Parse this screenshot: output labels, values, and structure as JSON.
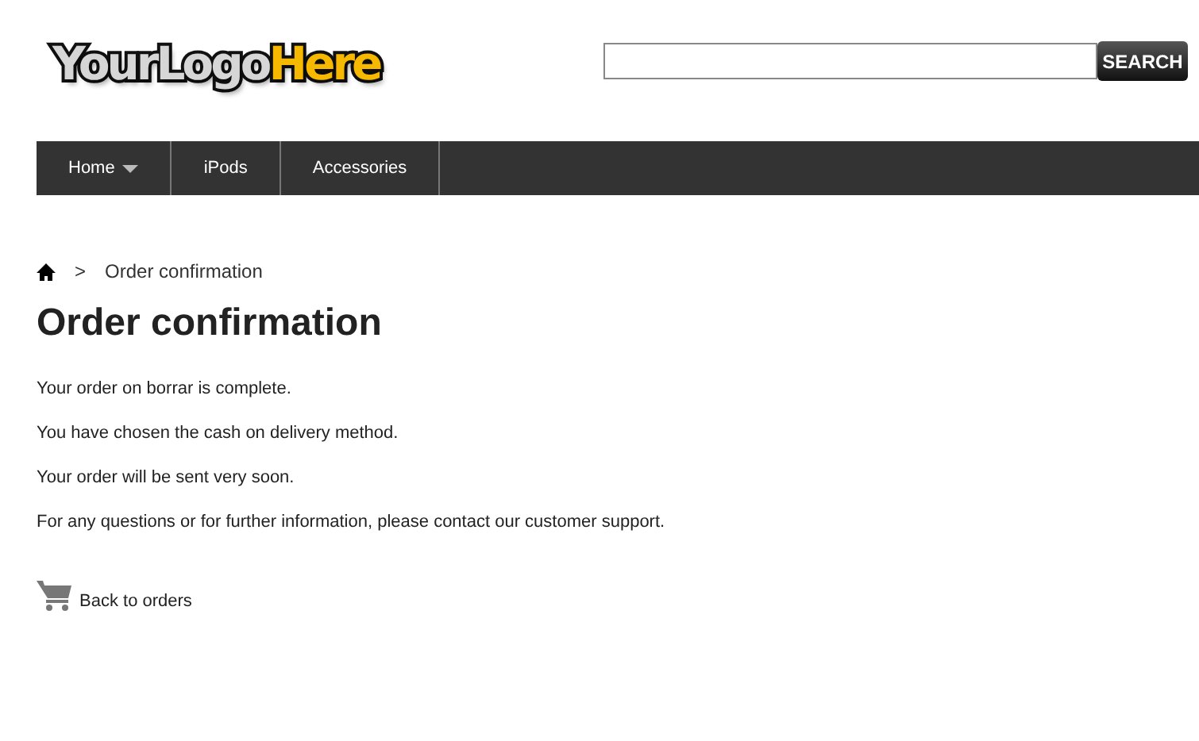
{
  "logo": [
    {
      "text": "YourLogo",
      "kind": "plain"
    },
    {
      "text": "Here",
      "kind": "accent"
    }
  ],
  "search": {
    "button": "SEARCH"
  },
  "nav": [
    {
      "label": "Home",
      "dropdown": true
    },
    {
      "label": "iPods",
      "dropdown": false
    },
    {
      "label": "Accessories",
      "dropdown": false
    }
  ],
  "breadcrumb": {
    "separator": ">",
    "current": "Order confirmation"
  },
  "heading": "Order confirmation",
  "paragraphs": [
    "Your order on borrar is complete.",
    "You have chosen the cash on delivery method.",
    "Your order will be sent very soon.",
    "For any questions or for further information, please contact our customer support."
  ],
  "back_link": "Back to orders"
}
